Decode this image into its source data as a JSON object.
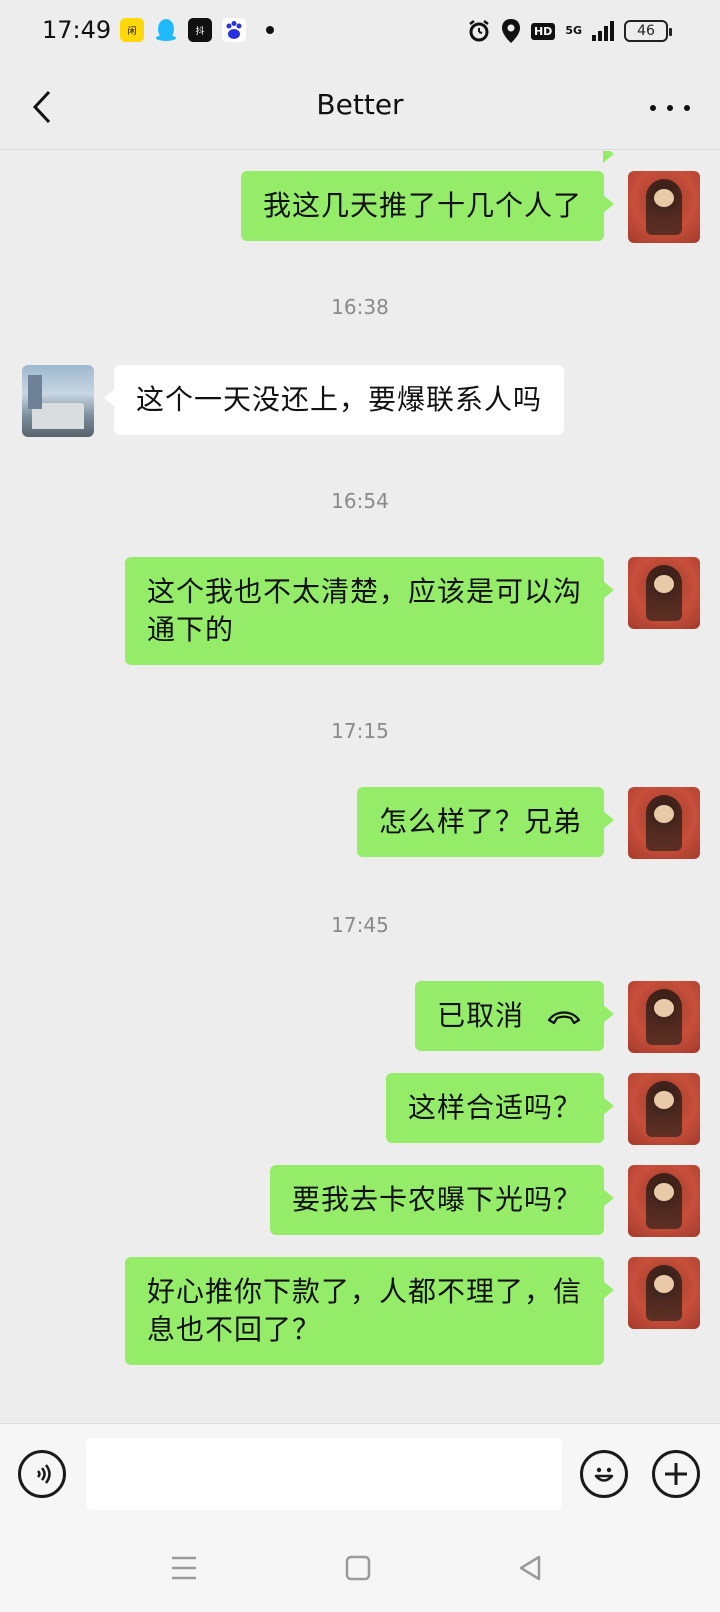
{
  "status_bar": {
    "time": "17:49",
    "app_icons": [
      "xianyu-icon",
      "qq-icon",
      "douyin-icon",
      "baidu-icon"
    ],
    "hd": "HD",
    "network": "5G",
    "battery": "46"
  },
  "header": {
    "title": "Better"
  },
  "messages": {
    "m1": "我这几天推了十几个人了",
    "ts1": "16:38",
    "m2": "这个一天没还上，要爆联系人吗",
    "ts2": "16:54",
    "m3_line1": "这个我也不太清楚，应该是可以沟",
    "m3_line2": "通下的",
    "ts3": "17:15",
    "m4": "怎么样了？兄弟",
    "ts4": "17:45",
    "m5": "已取消",
    "m6": "这样合适吗？",
    "m7": "要我去卡农曝下光吗？",
    "m8_line1": "好心推你下款了，人都不理了，信",
    "m8_line2": "息也不回了？"
  },
  "input": {
    "placeholder": ""
  },
  "colors": {
    "background": "#ededed",
    "my_bubble": "#95ec69",
    "other_bubble": "#ffffff",
    "timestamp": "#8a8a8a"
  }
}
